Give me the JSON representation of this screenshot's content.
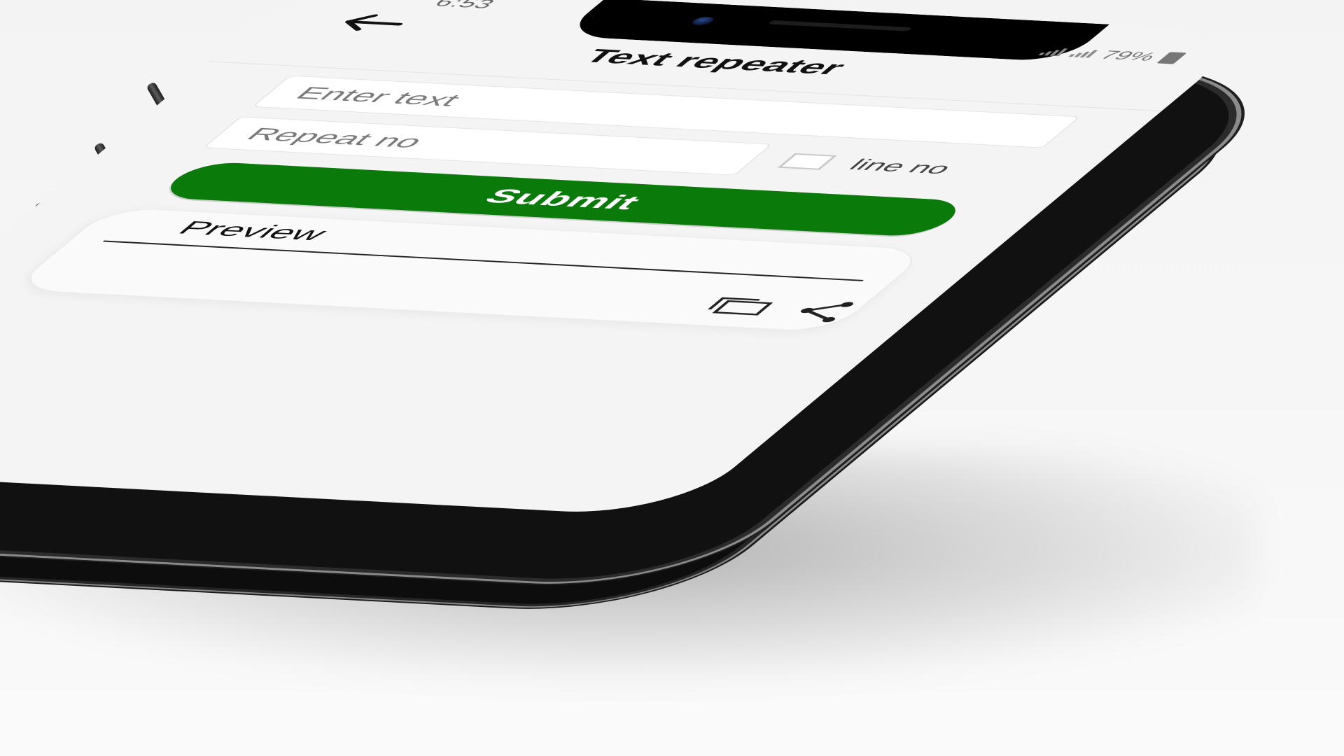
{
  "status_bar": {
    "time": "6:53",
    "battery": "79%"
  },
  "app_bar": {
    "title": "Text repeater",
    "back_icon": "arrow-left-icon"
  },
  "form": {
    "text_input": {
      "placeholder": "Enter text",
      "value": ""
    },
    "repeat_input": {
      "placeholder": "Repeat no",
      "value": ""
    },
    "line_no_checkbox": {
      "label": "line no",
      "checked": false
    },
    "submit_label": "Submit"
  },
  "preview": {
    "title": "Preview",
    "copy_icon": "copy-icon",
    "share_icon": "share-icon"
  },
  "colors": {
    "accent": "#0a7a0a",
    "screen_bg": "#f4f4f4"
  }
}
